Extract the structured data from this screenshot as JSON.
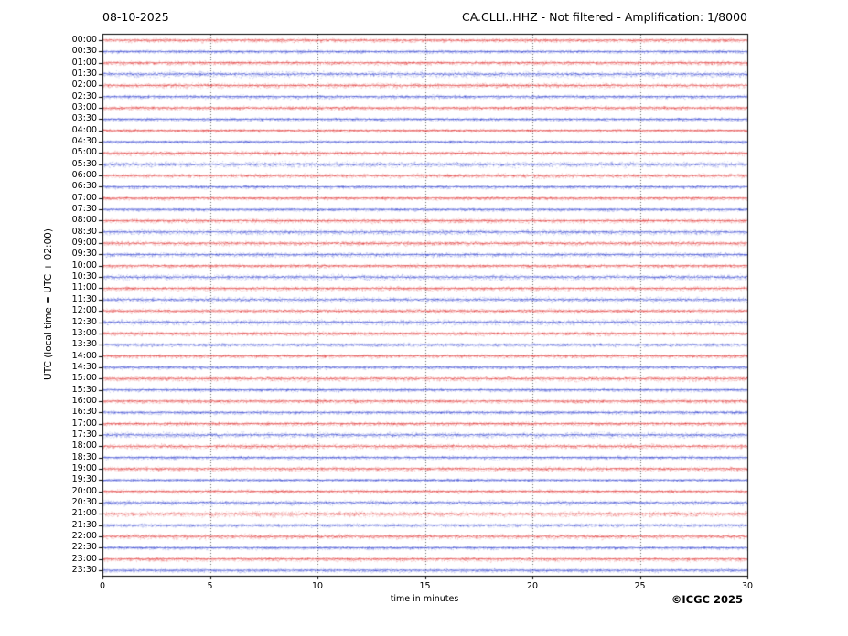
{
  "figure": {
    "date_title": "08-10-2025",
    "station_title": "CA.CLLI..HHZ - Not filtered - Amplification: 1/8000",
    "copyright": "©ICGC 2025"
  },
  "chart_data": {
    "type": "line",
    "subtype": "helicorder-daily-seismogram",
    "title": "CA.CLLI..HHZ - Not filtered - Amplification: 1/8000",
    "date": "08-10-2025",
    "xlabel": "time in minutes",
    "ylabel": "UTC (local time = UTC + 02:00)",
    "xlim": [
      0,
      30
    ],
    "x_ticks": [
      0,
      5,
      10,
      15,
      20,
      25,
      30
    ],
    "grid_x_minutes": [
      5,
      10,
      15,
      20,
      25
    ],
    "grid_style": "dotted-vertical",
    "minutes_per_row": 30,
    "legend": "none",
    "trace_colors": {
      "red": "#dd2222",
      "blue": "#2233cc"
    },
    "rows": [
      {
        "time": "00:00",
        "color": "red",
        "noise_amplitude": 1.2
      },
      {
        "time": "00:30",
        "color": "blue",
        "noise_amplitude": 1.0
      },
      {
        "time": "01:00",
        "color": "red",
        "noise_amplitude": 1.3
      },
      {
        "time": "01:30",
        "color": "blue",
        "noise_amplitude": 1.8
      },
      {
        "time": "02:00",
        "color": "red",
        "noise_amplitude": 1.5
      },
      {
        "time": "02:30",
        "color": "blue",
        "noise_amplitude": 1.2
      },
      {
        "time": "03:00",
        "color": "red",
        "noise_amplitude": 1.2
      },
      {
        "time": "03:30",
        "color": "blue",
        "noise_amplitude": 1.0
      },
      {
        "time": "04:00",
        "color": "red",
        "noise_amplitude": 1.0
      },
      {
        "time": "04:30",
        "color": "blue",
        "noise_amplitude": 1.0
      },
      {
        "time": "05:00",
        "color": "red",
        "noise_amplitude": 1.4
      },
      {
        "time": "05:30",
        "color": "blue",
        "noise_amplitude": 1.7
      },
      {
        "time": "06:00",
        "color": "red",
        "noise_amplitude": 1.3
      },
      {
        "time": "06:30",
        "color": "blue",
        "noise_amplitude": 1.1
      },
      {
        "time": "07:00",
        "color": "red",
        "noise_amplitude": 1.0
      },
      {
        "time": "07:30",
        "color": "blue",
        "noise_amplitude": 0.9
      },
      {
        "time": "08:00",
        "color": "red",
        "noise_amplitude": 1.3
      },
      {
        "time": "08:30",
        "color": "blue",
        "noise_amplitude": 1.6
      },
      {
        "time": "09:00",
        "color": "red",
        "noise_amplitude": 1.4
      },
      {
        "time": "09:30",
        "color": "blue",
        "noise_amplitude": 1.4
      },
      {
        "time": "10:00",
        "color": "red",
        "noise_amplitude": 1.1
      },
      {
        "time": "10:30",
        "color": "blue",
        "noise_amplitude": 1.7
      },
      {
        "time": "11:00",
        "color": "red",
        "noise_amplitude": 1.3
      },
      {
        "time": "11:30",
        "color": "blue",
        "noise_amplitude": 1.7
      },
      {
        "time": "12:00",
        "color": "red",
        "noise_amplitude": 1.4
      },
      {
        "time": "12:30",
        "color": "blue",
        "noise_amplitude": 1.8
      },
      {
        "time": "13:00",
        "color": "red",
        "noise_amplitude": 1.3
      },
      {
        "time": "13:30",
        "color": "blue",
        "noise_amplitude": 1.1
      },
      {
        "time": "14:00",
        "color": "red",
        "noise_amplitude": 1.2
      },
      {
        "time": "14:30",
        "color": "blue",
        "noise_amplitude": 1.1
      },
      {
        "time": "15:00",
        "color": "red",
        "noise_amplitude": 1.5
      },
      {
        "time": "15:30",
        "color": "blue",
        "noise_amplitude": 1.0
      },
      {
        "time": "16:00",
        "color": "red",
        "noise_amplitude": 1.2
      },
      {
        "time": "16:30",
        "color": "blue",
        "noise_amplitude": 1.1
      },
      {
        "time": "17:00",
        "color": "red",
        "noise_amplitude": 1.2
      },
      {
        "time": "17:30",
        "color": "blue",
        "noise_amplitude": 1.7
      },
      {
        "time": "18:00",
        "color": "red",
        "noise_amplitude": 1.5
      },
      {
        "time": "18:30",
        "color": "blue",
        "noise_amplitude": 1.1
      },
      {
        "time": "19:00",
        "color": "red",
        "noise_amplitude": 1.3
      },
      {
        "time": "19:30",
        "color": "blue",
        "noise_amplitude": 1.0
      },
      {
        "time": "20:00",
        "color": "red",
        "noise_amplitude": 1.2
      },
      {
        "time": "20:30",
        "color": "blue",
        "noise_amplitude": 1.5
      },
      {
        "time": "21:00",
        "color": "red",
        "noise_amplitude": 1.6
      },
      {
        "time": "21:30",
        "color": "blue",
        "noise_amplitude": 1.1
      },
      {
        "time": "22:00",
        "color": "red",
        "noise_amplitude": 1.5
      },
      {
        "time": "22:30",
        "color": "blue",
        "noise_amplitude": 1.0
      },
      {
        "time": "23:00",
        "color": "red",
        "noise_amplitude": 1.4
      },
      {
        "time": "23:30",
        "color": "blue",
        "noise_amplitude": 1.1
      }
    ]
  }
}
